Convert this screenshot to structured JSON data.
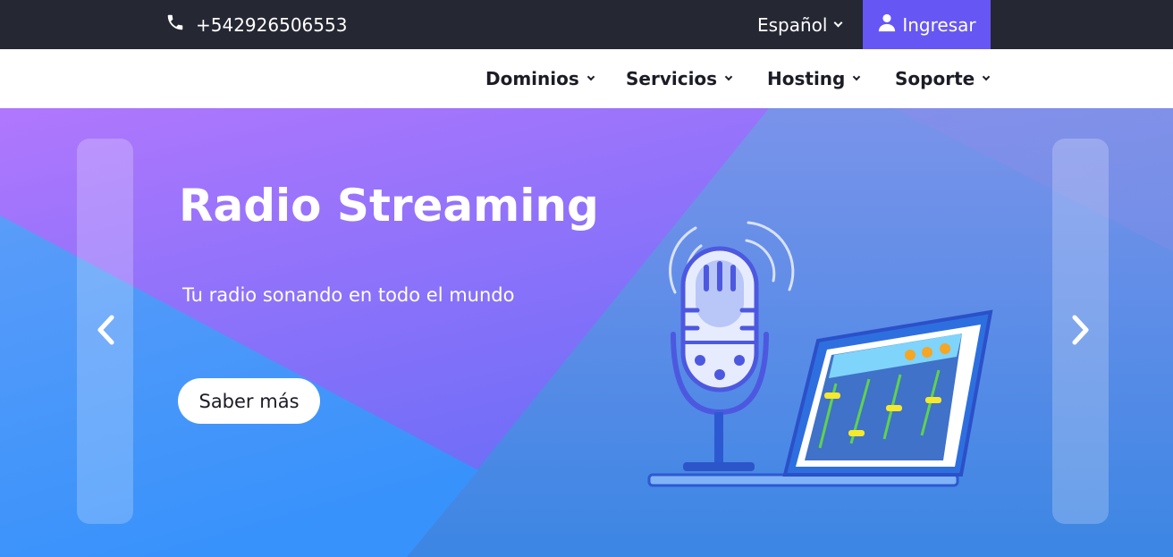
{
  "topbar": {
    "phone": "+542926506553",
    "phone_icon": "phone-icon",
    "language": "Español",
    "login_label": "Ingresar",
    "login_icon": "user-icon",
    "colors": {
      "background": "#252733",
      "login_background": "#6656f4"
    }
  },
  "nav": {
    "items": [
      {
        "label": "Dominios"
      },
      {
        "label": "Servicios"
      },
      {
        "label": "Hosting"
      },
      {
        "label": "Soporte"
      }
    ]
  },
  "hero": {
    "title": "Radio Streaming",
    "subtitle": "Tu radio sonando en todo el mundo",
    "button_label": "Saber más",
    "prev_icon": "chevron-left-icon",
    "next_icon": "chevron-right-icon",
    "illustration": "microphone-and-laptop-illustration",
    "colors": {
      "purple": "#a470fb",
      "blue": "#3a8ef8",
      "accent": "#5b5ff0"
    }
  }
}
